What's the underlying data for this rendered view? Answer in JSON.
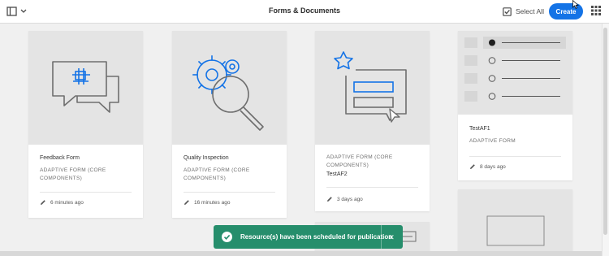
{
  "header": {
    "title": "Forms & Documents",
    "select_all_label": "Select All",
    "create_label": "Create",
    "accent_color": "#1473e6"
  },
  "cards": [
    {
      "title": "Feedback Form",
      "type": "ADAPTIVE FORM (CORE COMPONENTS)",
      "modified": "6 minutes ago",
      "icon": "feedback-chat-icon"
    },
    {
      "title": "Quality Inspection",
      "type": "ADAPTIVE FORM (CORE COMPONENTS)",
      "modified": "16 minutes ago",
      "icon": "gear-search-icon"
    },
    {
      "title": "",
      "type": "ADAPTIVE FORM (CORE COMPONENTS)",
      "subtitle": "TestAF2",
      "modified": "3 days ago",
      "icon": "star-form-icon"
    },
    {
      "title": "TestAF1",
      "type": "ADAPTIVE FORM",
      "modified": "8 days ago",
      "icon": "radio-list-icon"
    }
  ],
  "toast": {
    "message": "Resource(s) have been scheduled for publication",
    "close_label": "✕",
    "color": "#268e6c"
  }
}
